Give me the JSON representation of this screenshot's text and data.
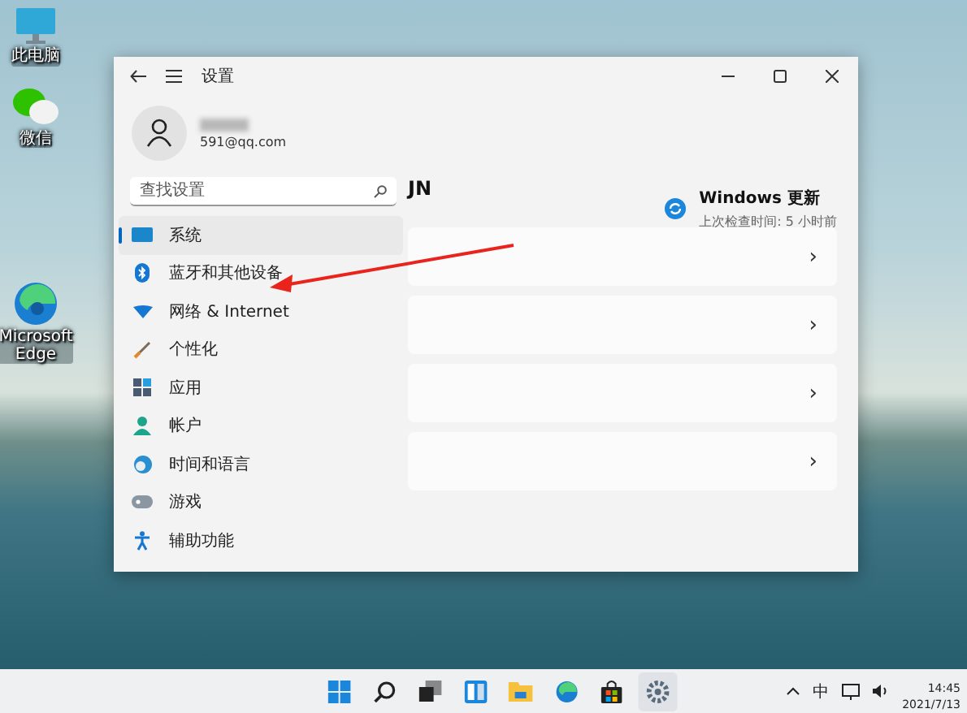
{
  "desktop_icons": [
    {
      "kind": "pc",
      "label": "此电脑"
    },
    {
      "kind": "wechat",
      "label": "微信"
    },
    {
      "kind": "edge",
      "label": "Microsoft Edge"
    }
  ],
  "window": {
    "title": "设置",
    "account": {
      "email": "591@qq.com"
    },
    "search": {
      "placeholder": "查找设置"
    },
    "sidebar": {
      "items": [
        {
          "kind": "system",
          "label": "系统",
          "selected": true
        },
        {
          "kind": "bluetooth",
          "label": "蓝牙和其他设备",
          "selected": false
        },
        {
          "kind": "network",
          "label": "网络 & Internet",
          "selected": false
        },
        {
          "kind": "brush",
          "label": "个性化",
          "selected": false
        },
        {
          "kind": "apps",
          "label": "应用",
          "selected": false
        },
        {
          "kind": "account",
          "label": "帐户",
          "selected": false
        },
        {
          "kind": "time",
          "label": "时间和语言",
          "selected": false
        },
        {
          "kind": "game",
          "label": "游戏",
          "selected": false
        },
        {
          "kind": "access",
          "label": "辅助功能",
          "selected": false
        }
      ]
    },
    "heading": "JN",
    "update": {
      "title": "Windows 更新",
      "subtitle": "上次检查时间: 5 小时前"
    },
    "cards": [
      {
        "chevron": "›"
      },
      {
        "chevron": "›"
      },
      {
        "chevron": "›"
      },
      {
        "chevron": "›"
      }
    ]
  },
  "taskbar": {
    "apps": [
      {
        "kind": "start",
        "selected": false
      },
      {
        "kind": "search",
        "selected": false
      },
      {
        "kind": "taskview",
        "selected": false
      },
      {
        "kind": "widgets",
        "selected": false
      },
      {
        "kind": "explorer",
        "selected": false
      },
      {
        "kind": "edge",
        "selected": false
      },
      {
        "kind": "store",
        "selected": false
      },
      {
        "kind": "settings",
        "selected": true
      }
    ],
    "ime": "中",
    "time": "14:45",
    "date": "2021/7/13"
  }
}
